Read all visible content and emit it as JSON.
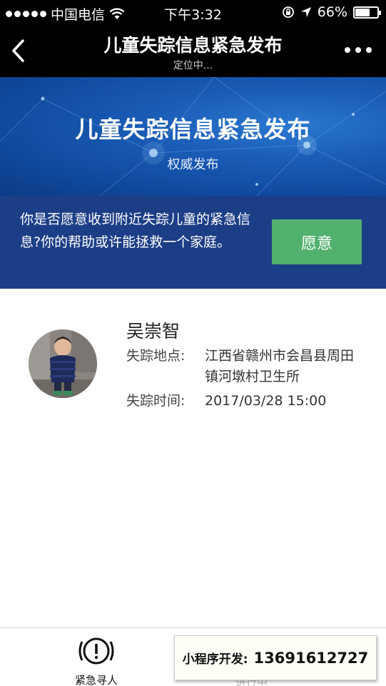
{
  "status_bar": {
    "carrier": "中国电信",
    "time": "下午3:32",
    "battery": "66%",
    "battery_level": 0.66
  },
  "nav": {
    "title": "儿童失踪信息紧急发布",
    "subtitle": "定位中..."
  },
  "banner": {
    "title": "儿童失踪信息紧急发布",
    "subtitle": "权威发布"
  },
  "prompt": {
    "text": "你是否愿意收到附近失踪儿童的紧急信息?你的帮助或许能拯救一个家庭。",
    "button": "愿意"
  },
  "missing_child": {
    "name": "吴崇智",
    "location_label": "失踪地点:",
    "location": "江西省赣州市会昌县周田镇河墩村卫生所",
    "time_label": "失踪时间:",
    "time": "2017/03/28 15:00"
  },
  "tab_bar": {
    "tabs": [
      {
        "label": "紧急寻人",
        "icon": "alert-circle-icon"
      },
      {
        "label": "进行中"
      }
    ]
  },
  "dev_overlay": {
    "label": "小程序开发:",
    "phone": "13691612727"
  }
}
